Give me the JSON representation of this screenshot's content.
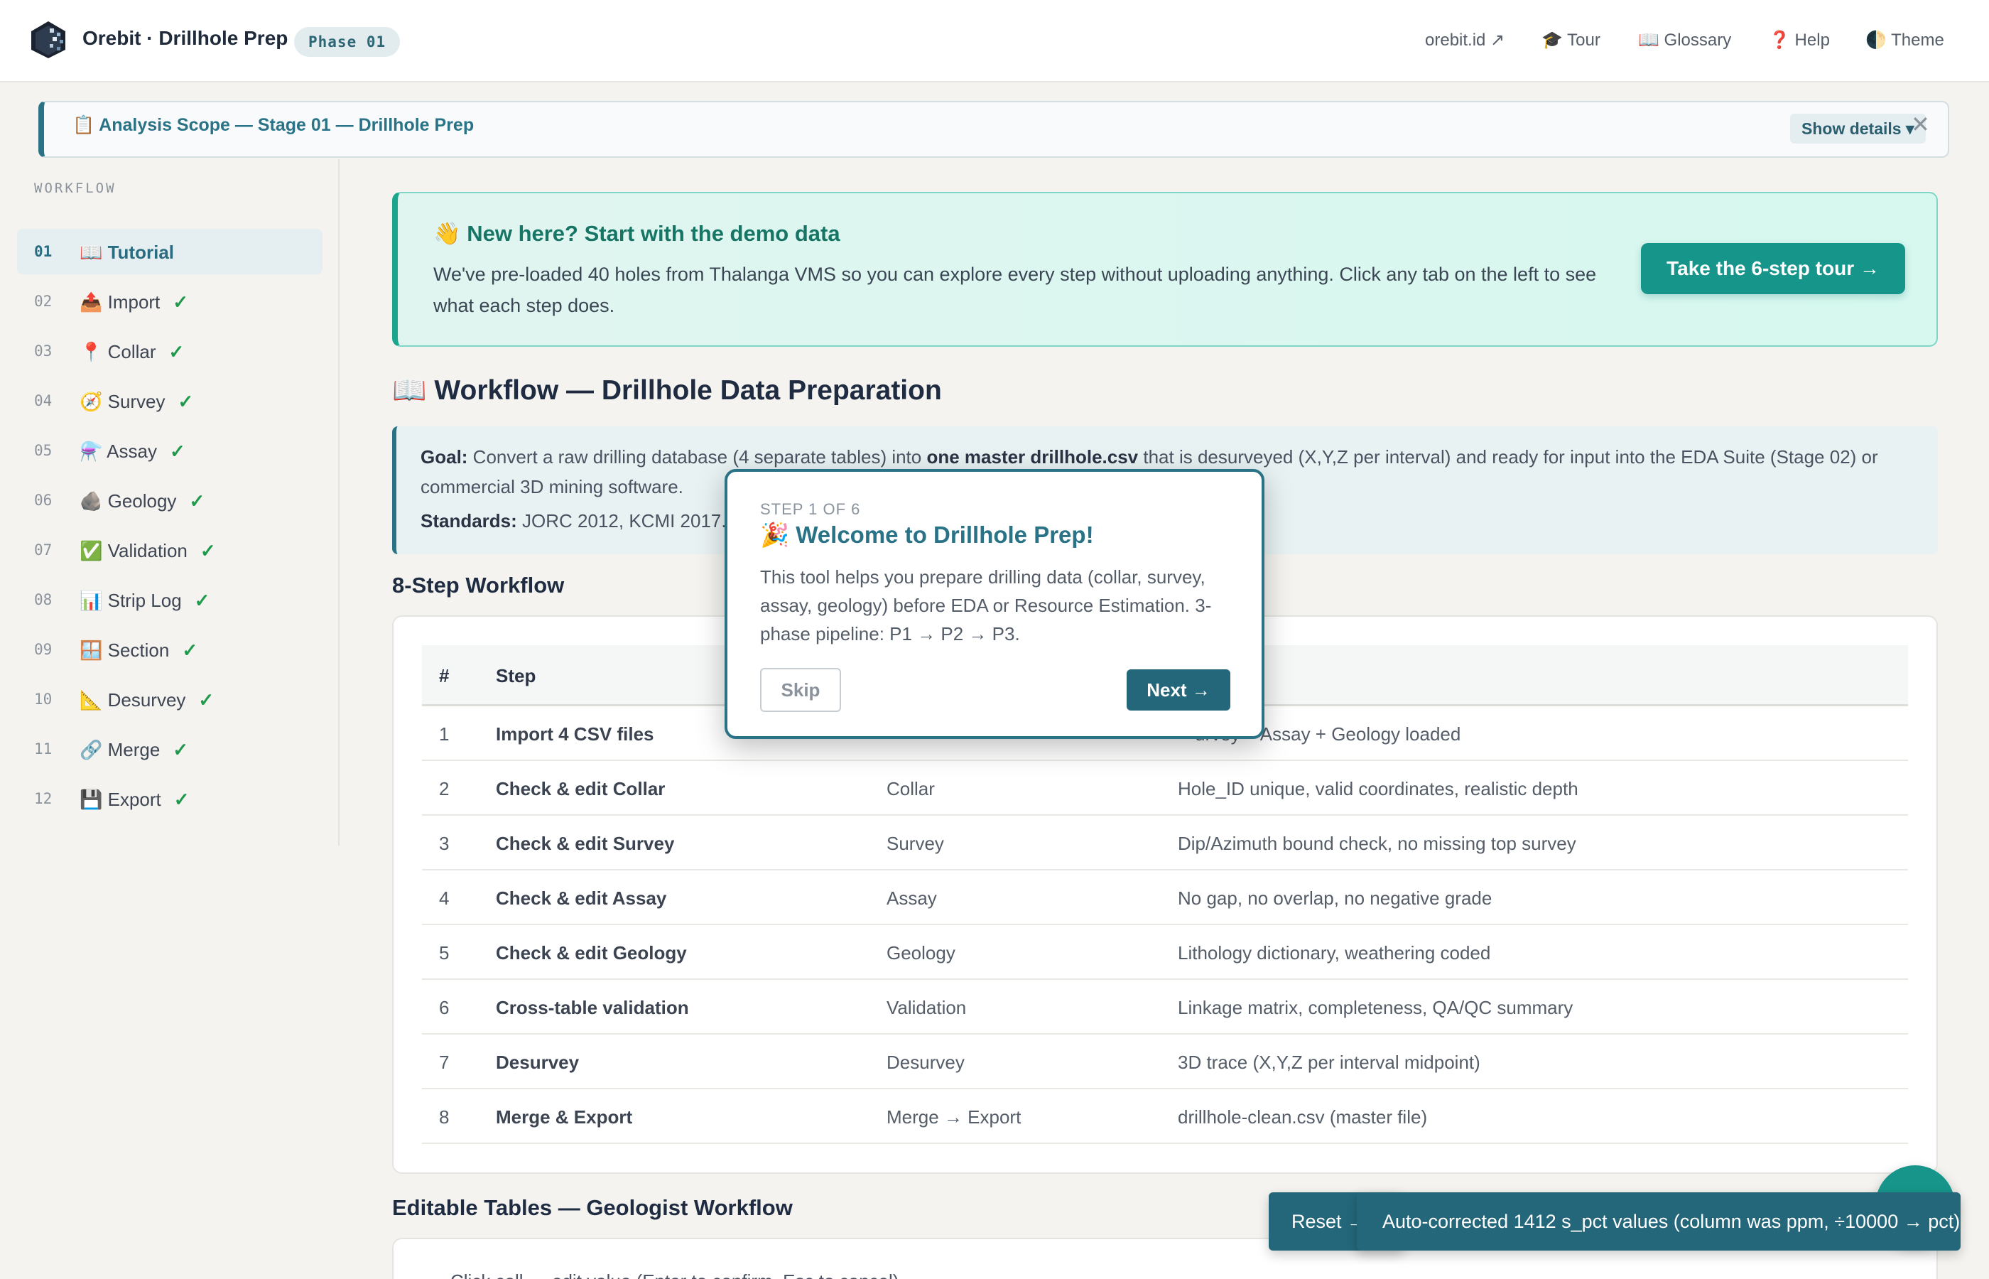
{
  "header": {
    "app_title": "Orebit · Drillhole Prep",
    "phase_badge": "Phase 01",
    "nav": {
      "orebit": "orebit.id ↗",
      "tour": "🎓 Tour",
      "glossary": "📖 Glossary",
      "help": "❓ Help",
      "theme": "🌓 Theme"
    }
  },
  "scope": {
    "title": "📋 Analysis Scope — Stage 01 — Drillhole Prep",
    "details_button": "Show details ▾",
    "close": "✕"
  },
  "sidebar": {
    "heading": "WORKFLOW",
    "check": "✓",
    "items": [
      {
        "num": "01",
        "label": "📖 Tutorial"
      },
      {
        "num": "02",
        "label": "📤 Import"
      },
      {
        "num": "03",
        "label": "📍 Collar"
      },
      {
        "num": "04",
        "label": "🧭 Survey"
      },
      {
        "num": "05",
        "label": "⚗️ Assay"
      },
      {
        "num": "06",
        "label": "🪨 Geology"
      },
      {
        "num": "07",
        "label": "✅ Validation"
      },
      {
        "num": "08",
        "label": "📊 Strip Log"
      },
      {
        "num": "09",
        "label": "🪟 Section"
      },
      {
        "num": "10",
        "label": "📐 Desurvey"
      },
      {
        "num": "11",
        "label": "🔗 Merge"
      },
      {
        "num": "12",
        "label": "💾 Export"
      }
    ]
  },
  "hero": {
    "title": "👋 New here? Start with the demo data",
    "text": "We've pre-loaded 40 holes from Thalanga VMS so you can explore every step without uploading anything. Click any tab on the left to see what each step does.",
    "button": "Take the 6-step tour →"
  },
  "workflow": {
    "title": "📖 Workflow — Drillhole Data Preparation",
    "goal_label": "Goal:",
    "goal_text_1": " Convert a raw drilling database (4 separate tables) into ",
    "goal_bold": "one master drillhole.csv",
    "goal_text_2": " that is desurveyed (X,Y,Z per interval) and ready for input into the EDA Suite (Stage 02) or commercial 3D mining software.",
    "standards_label": "Standards:",
    "standards_text": " JORC 2012, KCMI 2017."
  },
  "steps": {
    "title": "8-Step Workflow",
    "headers": {
      "num": "#",
      "step": "Step",
      "tab": "",
      "check": ""
    },
    "rows": [
      {
        "num": "1",
        "step": "Import 4 CSV files",
        "tab": "",
        "check": "urvey + Assay + Geology loaded"
      },
      {
        "num": "2",
        "step": "Check & edit Collar",
        "tab": "Collar",
        "check": "Hole_ID unique, valid coordinates, realistic depth"
      },
      {
        "num": "3",
        "step": "Check & edit Survey",
        "tab": "Survey",
        "check": "Dip/Azimuth bound check, no missing top survey"
      },
      {
        "num": "4",
        "step": "Check & edit Assay",
        "tab": "Assay",
        "check": "No gap, no overlap, no negative grade"
      },
      {
        "num": "5",
        "step": "Check & edit Geology",
        "tab": "Geology",
        "check": "Lithology dictionary, weathering coded"
      },
      {
        "num": "6",
        "step": "Cross-table validation",
        "tab": "Validation",
        "check": "Linkage matrix, completeness, QA/QC summary"
      },
      {
        "num": "7",
        "step": "Desurvey",
        "tab": "Desurvey",
        "check": "3D trace (X,Y,Z per interval midpoint)"
      },
      {
        "num": "8",
        "step": "Merge & Export",
        "tab": "Merge → Export",
        "check": "drillhole-clean.csv (master file)"
      }
    ]
  },
  "editable": {
    "title": "Editable Tables — Geologist Workflow",
    "text": "Click cell → edit value (Enter to confirm, Esc to cancel)"
  },
  "tour_popover": {
    "step": "STEP 1 OF 6",
    "title": "🎉 Welcome to Drillhole Prep!",
    "text": "This tool helps you prepare drilling data (collar, survey, assay, geology) before EDA or Resource Estimation. 3-phase pipeline: P1 → P2 → P3.",
    "skip": "Skip",
    "next": "Next →"
  },
  "toasts": {
    "reset": "Reset →",
    "main": "Auto-corrected 1412 s_pct values (column was ppm, ÷10000 → pct)"
  },
  "colors": {
    "accent": "#2a7387",
    "hero_button": "#16958a",
    "check": "#1f9a4c"
  }
}
